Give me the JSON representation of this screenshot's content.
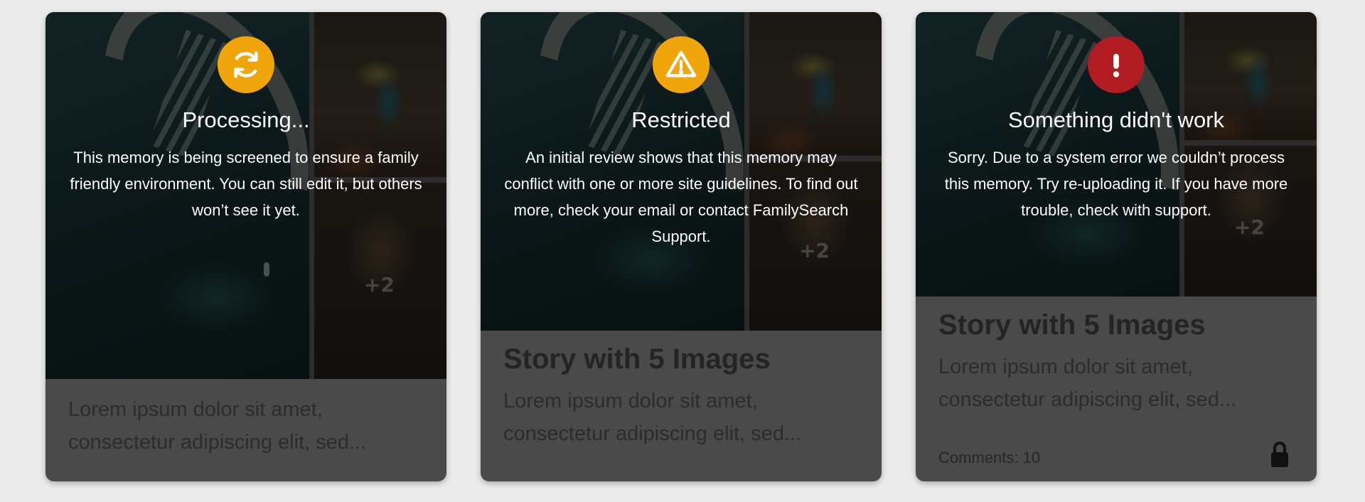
{
  "cards": [
    {
      "status": "processing",
      "status_color": "#f0a60b",
      "status_icon": "refresh-icon",
      "status_title": "Processing...",
      "status_message": "This memory is being screened to ensure a family friendly environment. You can still edit it, but others won’t see it yet.",
      "more_images": "+2",
      "description": "Lorem ipsum dolor sit amet, consectetur adipiscing elit, sed..."
    },
    {
      "status": "restricted",
      "status_color": "#f0a60b",
      "status_icon": "warning-icon",
      "status_title": "Restricted",
      "status_message": "An initial review shows that this memory may conflict with one or more site guidelines. To find out more, check your email or contact FamilySearch Support.",
      "more_images": "+2",
      "title": "Story with 5 Images",
      "description": "Lorem ipsum dolor sit amet, consectetur adipiscing elit, sed..."
    },
    {
      "status": "error",
      "status_color": "#b01c21",
      "status_icon": "exclamation-icon",
      "status_title": "Something didn't work",
      "status_message": "Sorry. Due to a system error we couldn’t process this memory. Try re-uploading it. If you have more trouble, check with support.",
      "more_images": "+2",
      "title": "Story with 5 Images",
      "description": "Lorem ipsum dolor sit amet, consectetur adipiscing elit, sed...",
      "comments": "Comments: 10",
      "privacy_icon": "lock-icon"
    }
  ]
}
